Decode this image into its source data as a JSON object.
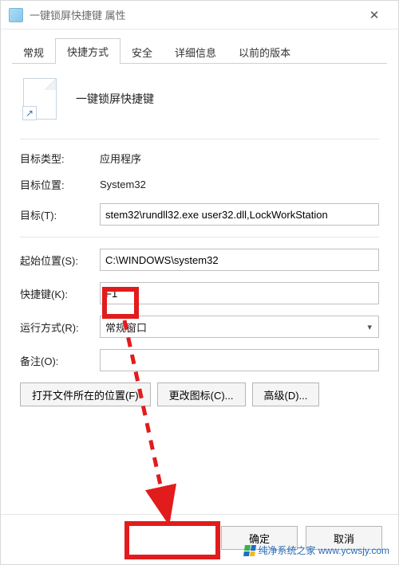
{
  "window": {
    "title": "一键锁屏快捷键 属性"
  },
  "tabs": {
    "general": "常规",
    "shortcut": "快捷方式",
    "security": "安全",
    "details": "详细信息",
    "previous": "以前的版本"
  },
  "header": {
    "name": "一键锁屏快捷键"
  },
  "fields": {
    "target_type_label": "目标类型:",
    "target_type_value": "应用程序",
    "target_location_label": "目标位置:",
    "target_location_value": "System32",
    "target_label": "目标(T):",
    "target_value": "stem32\\rundll32.exe user32.dll,LockWorkStation",
    "start_in_label": "起始位置(S):",
    "start_in_value": "C:\\WINDOWS\\system32",
    "shortcutkey_label": "快捷键(K):",
    "shortcutkey_value": "F1",
    "run_label": "运行方式(R):",
    "run_value": "常规窗口",
    "comment_label": "备注(O):",
    "comment_value": ""
  },
  "buttons": {
    "open_location": "打开文件所在的位置(F)",
    "change_icon": "更改图标(C)...",
    "advanced": "高级(D)...",
    "ok": "确定",
    "cancel": "取消"
  },
  "watermark": "纯净系统之家 www.ycwsjy.com"
}
